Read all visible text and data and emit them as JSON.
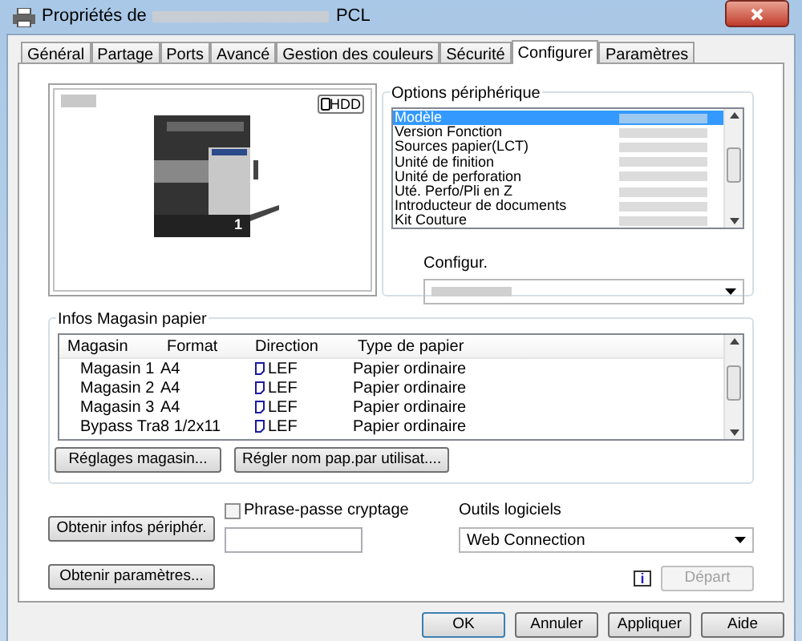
{
  "window": {
    "title_prefix": "Propriétés de",
    "title_suffix": "PCL"
  },
  "tabs": [
    {
      "label": "Général",
      "selected": false
    },
    {
      "label": "Partage",
      "selected": false
    },
    {
      "label": "Ports",
      "selected": false
    },
    {
      "label": "Avancé",
      "selected": false
    },
    {
      "label": "Gestion des couleurs",
      "selected": false
    },
    {
      "label": "Sécurité",
      "selected": false
    },
    {
      "label": "Configurer",
      "selected": true
    },
    {
      "label": "Paramètres",
      "selected": false
    }
  ],
  "preview": {
    "badge": "HDD",
    "tray_number": "1"
  },
  "device_options": {
    "title": "Options périphérique",
    "items": [
      {
        "label": "Modèle",
        "selected": true
      },
      {
        "label": "Version Fonction",
        "selected": false
      },
      {
        "label": "Sources papier(LCT)",
        "selected": false
      },
      {
        "label": "Unité de finition",
        "selected": false
      },
      {
        "label": "Unité de perforation",
        "selected": false
      },
      {
        "label": "Uté. Perfo/Pli en Z",
        "selected": false
      },
      {
        "label": "Introducteur de documents",
        "selected": false
      },
      {
        "label": "Kit Couture",
        "selected": false
      }
    ],
    "config_label": "Configur."
  },
  "paper_trays": {
    "title": "Infos Magasin papier",
    "columns": [
      "Magasin",
      "Format",
      "Direction",
      "Type de papier"
    ],
    "rows": [
      [
        "Magasin 1",
        "A4",
        "LEF",
        "Papier ordinaire"
      ],
      [
        "Magasin 2",
        "A4",
        "LEF",
        "Papier ordinaire"
      ],
      [
        "Magasin 3",
        "A4",
        "LEF",
        "Papier ordinaire"
      ],
      [
        "Bypass Tra",
        "8 1/2x11",
        "LEF",
        "Papier ordinaire"
      ]
    ],
    "buttons": [
      "Réglages magasin...",
      "Régler nom pap.par utilisat...."
    ]
  },
  "get_info_button": "Obtenir infos périphér.",
  "get_settings_button": "Obtenir paramètres...",
  "passphrase": {
    "label": "Phrase-passe cryptage",
    "checked": false
  },
  "software_tools": {
    "label": "Outils logiciels",
    "value": "Web Connection",
    "info_icon": "i",
    "start_button": "Départ",
    "start_disabled": true
  },
  "dialog_buttons": [
    {
      "label": "OK",
      "default": true
    },
    {
      "label": "Annuler",
      "default": false
    },
    {
      "label": "Appliquer",
      "default": false
    },
    {
      "label": "Aide",
      "default": false
    }
  ]
}
